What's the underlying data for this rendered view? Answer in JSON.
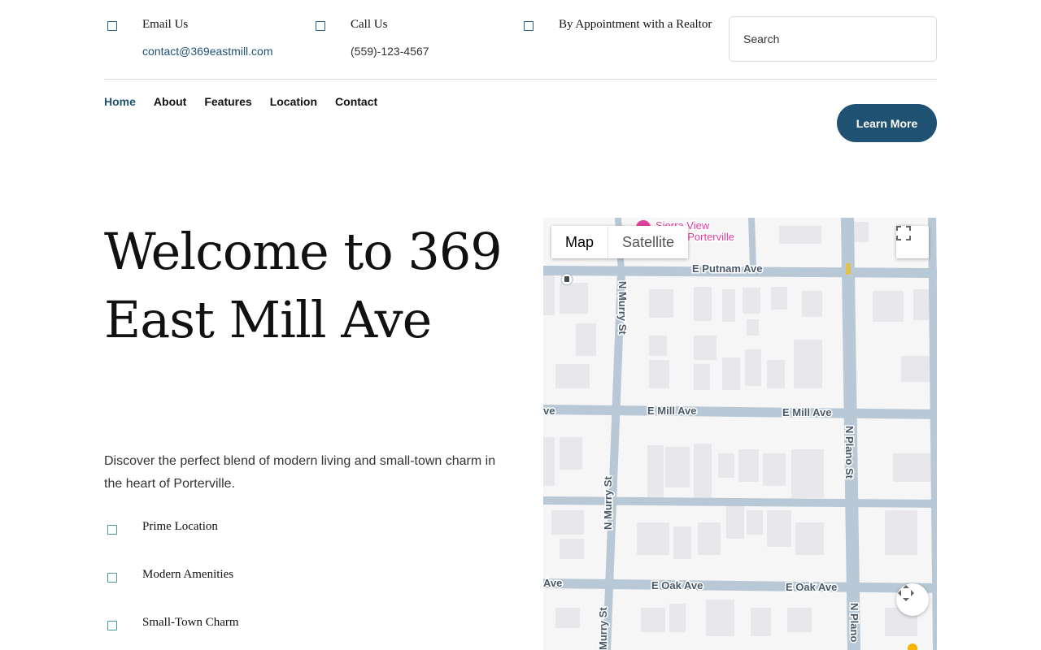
{
  "contacts": [
    {
      "title": "Email Us",
      "value": "contact@369eastmill.com"
    },
    {
      "title": "Call Us",
      "value": "(559)-123-4567"
    },
    {
      "title": "By Appointment with a Realtor",
      "value": ""
    }
  ],
  "search": {
    "placeholder": "Search"
  },
  "nav": [
    "Home",
    "About",
    "Features",
    "Location",
    "Contact"
  ],
  "cta": {
    "learn_more": "Learn More"
  },
  "hero": {
    "title": "Welcome to 369 East Mill Ave",
    "description": "Discover the perfect blend of modern living and small-town charm in the heart of Porterville."
  },
  "features": [
    "Prime Location",
    "Modern Amenities",
    "Small-Town Charm"
  ],
  "map": {
    "type_map": "Map",
    "type_satellite": "Satellite",
    "poi": [
      "Sierra View",
      "t Porterville"
    ],
    "streets": {
      "putnam": "E Putnam Ave",
      "mill": "E Mill Ave",
      "oak": "E Oak Ave",
      "mill_edge": "ve",
      "oak_edge": "Ave",
      "murry": "N Murry St",
      "murry_mid": "N Murry St",
      "murry_low": "Murry St",
      "plano": "N Plano St",
      "plano_low": "N Plano"
    }
  },
  "colors": {
    "accent": "#1f5172",
    "road": "#b9c8d6",
    "building": "#e8e8ec",
    "poi": "#e040a0"
  }
}
